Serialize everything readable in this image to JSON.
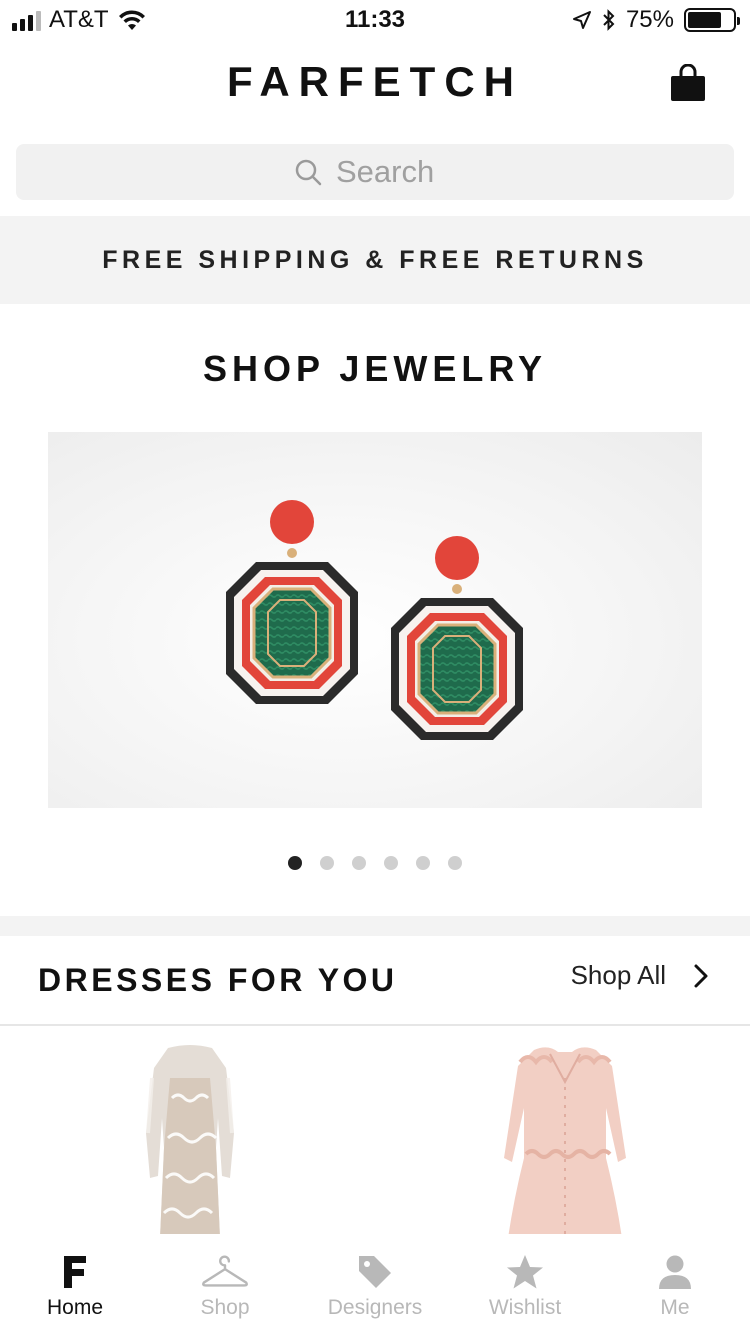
{
  "status_bar": {
    "carrier": "AT&T",
    "time": "11:33",
    "battery_text": "75%",
    "battery_level": 0.75,
    "signal_bars_active": 3,
    "signal_bars_total": 4
  },
  "header": {
    "logo": "FARFETCH",
    "bag_icon": "shopping-bag-icon"
  },
  "search": {
    "placeholder": "Search",
    "icon": "search-icon"
  },
  "promo": {
    "text": "FREE SHIPPING & FREE RETURNS"
  },
  "hero": {
    "title": "SHOP JEWELRY",
    "carousel_total": 6,
    "carousel_active_index": 0
  },
  "dresses": {
    "title": "DRESSES FOR YOU",
    "shop_all": "Shop All"
  },
  "tab_bar": {
    "tabs": [
      {
        "label": "Home",
        "icon": "farfetch-f-icon",
        "active": true
      },
      {
        "label": "Shop",
        "icon": "hanger-icon",
        "active": false
      },
      {
        "label": "Designers",
        "icon": "tag-icon",
        "active": false
      },
      {
        "label": "Wishlist",
        "icon": "star-icon",
        "active": false
      },
      {
        "label": "Me",
        "icon": "person-icon",
        "active": false
      }
    ]
  },
  "colors": {
    "accent_dark": "#111111",
    "inactive_gray": "#b8b8b8",
    "band_gray": "#f3f3f3"
  }
}
